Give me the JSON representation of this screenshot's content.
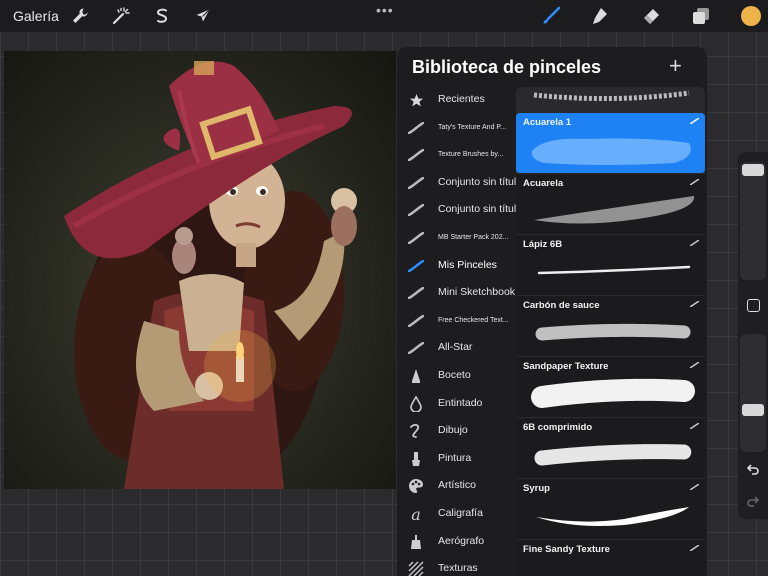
{
  "toolbar": {
    "gallery_label": "Galería",
    "left_icons": [
      "wrench-icon",
      "magic-wand-icon",
      "selection-s-icon",
      "arrow-cursor-icon"
    ],
    "more_label": "•••",
    "right_icons": [
      "brush-icon",
      "smudge-icon",
      "eraser-icon",
      "layers-icon"
    ],
    "current_color": "#f0b34a",
    "active_tool_color": "#2f8cff"
  },
  "panel": {
    "title": "Biblioteca de pinceles",
    "add_label": "+",
    "categories": [
      {
        "label": "Recientes",
        "icon": "star-icon"
      },
      {
        "label": "Taty's Texture And P...",
        "icon": "brush-stroke-icon"
      },
      {
        "label": "Texture Brushes by...",
        "icon": "brush-stroke-icon"
      },
      {
        "label": "Conjunto sin título",
        "icon": "brush-stroke-icon"
      },
      {
        "label": "Conjunto sin título",
        "icon": "brush-stroke-icon"
      },
      {
        "label": "MB Starter Pack 202...",
        "icon": "brush-stroke-icon"
      },
      {
        "label": "Mis Pinceles",
        "icon": "brush-stroke-icon"
      },
      {
        "label": "Mini Sketchbook",
        "icon": "brush-stroke-icon"
      },
      {
        "label": "Free Checkered Text...",
        "icon": "brush-stroke-icon"
      },
      {
        "label": "All-Star",
        "icon": "brush-stroke-icon"
      },
      {
        "label": "Boceto",
        "icon": "pencil-tip-icon"
      },
      {
        "label": "Entintado",
        "icon": "ink-drop-icon"
      },
      {
        "label": "Dibujo",
        "icon": "squiggle-icon"
      },
      {
        "label": "Pintura",
        "icon": "paint-brush-icon"
      },
      {
        "label": "Artístico",
        "icon": "palette-icon"
      },
      {
        "label": "Caligrafía",
        "icon": "calligraphy-a-icon"
      },
      {
        "label": "Aerógrafo",
        "icon": "airbrush-icon"
      },
      {
        "label": "Texturas",
        "icon": "texture-icon"
      }
    ],
    "brushes": [
      {
        "name": "Acuarela 1",
        "selected": true
      },
      {
        "name": "Acuarela",
        "selected": false
      },
      {
        "name": "Lápiz 6B",
        "selected": false
      },
      {
        "name": "Carbón de sauce",
        "selected": false
      },
      {
        "name": "Sandpaper Texture",
        "selected": false
      },
      {
        "name": "6B comprimido",
        "selected": false
      },
      {
        "name": "Syrup",
        "selected": false
      },
      {
        "name": "Fine Sandy Texture",
        "selected": false
      }
    ]
  }
}
